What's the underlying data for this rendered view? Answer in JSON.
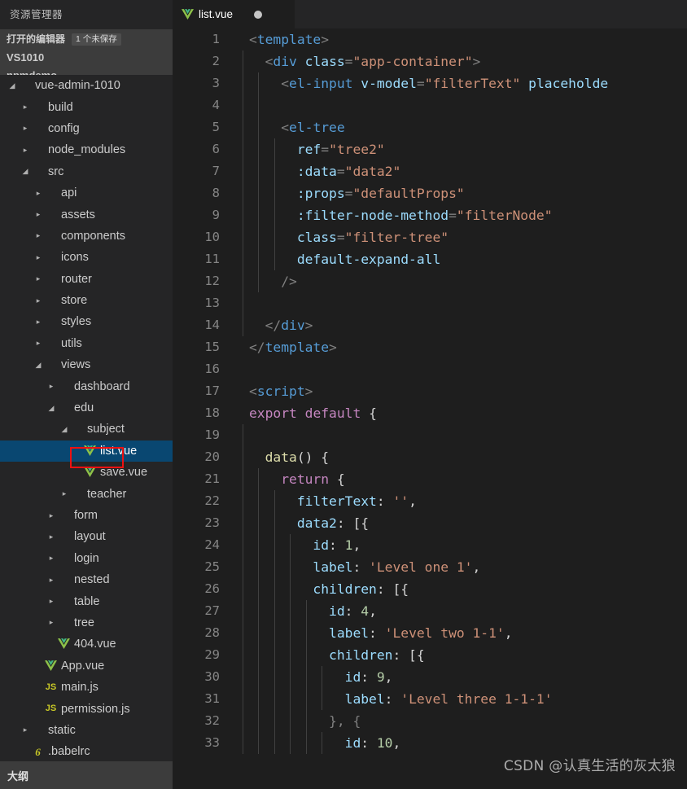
{
  "sidebar": {
    "title": "资源管理器",
    "open_editors": {
      "label": "打开的编辑器",
      "badge": "1 个未保存",
      "workspace": "VS1010"
    },
    "clipped_row_label": "npmdemo",
    "outline_label": "大纲",
    "selection_color": "#094771",
    "annotation_color": "#ee1111",
    "items": [
      {
        "label": "vue-admin-1010",
        "depth": 0,
        "twisty": "expanded",
        "icon": "folder"
      },
      {
        "label": "build",
        "depth": 1,
        "twisty": "collapsed",
        "icon": "folder"
      },
      {
        "label": "config",
        "depth": 1,
        "twisty": "collapsed",
        "icon": "folder"
      },
      {
        "label": "node_modules",
        "depth": 1,
        "twisty": "collapsed",
        "icon": "folder"
      },
      {
        "label": "src",
        "depth": 1,
        "twisty": "expanded",
        "icon": "folder"
      },
      {
        "label": "api",
        "depth": 2,
        "twisty": "collapsed",
        "icon": "folder"
      },
      {
        "label": "assets",
        "depth": 2,
        "twisty": "collapsed",
        "icon": "folder"
      },
      {
        "label": "components",
        "depth": 2,
        "twisty": "collapsed",
        "icon": "folder"
      },
      {
        "label": "icons",
        "depth": 2,
        "twisty": "collapsed",
        "icon": "folder"
      },
      {
        "label": "router",
        "depth": 2,
        "twisty": "collapsed",
        "icon": "folder"
      },
      {
        "label": "store",
        "depth": 2,
        "twisty": "collapsed",
        "icon": "folder"
      },
      {
        "label": "styles",
        "depth": 2,
        "twisty": "collapsed",
        "icon": "folder"
      },
      {
        "label": "utils",
        "depth": 2,
        "twisty": "collapsed",
        "icon": "folder"
      },
      {
        "label": "views",
        "depth": 2,
        "twisty": "expanded",
        "icon": "folder"
      },
      {
        "label": "dashboard",
        "depth": 3,
        "twisty": "collapsed",
        "icon": "folder"
      },
      {
        "label": "edu",
        "depth": 3,
        "twisty": "expanded",
        "icon": "folder"
      },
      {
        "label": "subject",
        "depth": 4,
        "twisty": "expanded",
        "icon": "folder"
      },
      {
        "label": "list.vue",
        "depth": 5,
        "twisty": "none",
        "icon": "vue",
        "selected": true
      },
      {
        "label": "save.vue",
        "depth": 5,
        "twisty": "none",
        "icon": "vue"
      },
      {
        "label": "teacher",
        "depth": 4,
        "twisty": "collapsed",
        "icon": "folder"
      },
      {
        "label": "form",
        "depth": 3,
        "twisty": "collapsed",
        "icon": "folder"
      },
      {
        "label": "layout",
        "depth": 3,
        "twisty": "collapsed",
        "icon": "folder"
      },
      {
        "label": "login",
        "depth": 3,
        "twisty": "collapsed",
        "icon": "folder"
      },
      {
        "label": "nested",
        "depth": 3,
        "twisty": "collapsed",
        "icon": "folder"
      },
      {
        "label": "table",
        "depth": 3,
        "twisty": "collapsed",
        "icon": "folder"
      },
      {
        "label": "tree",
        "depth": 3,
        "twisty": "collapsed",
        "icon": "folder"
      },
      {
        "label": "404.vue",
        "depth": 3,
        "twisty": "none",
        "icon": "vue"
      },
      {
        "label": "App.vue",
        "depth": 2,
        "twisty": "none",
        "icon": "vue"
      },
      {
        "label": "main.js",
        "depth": 2,
        "twisty": "none",
        "icon": "js"
      },
      {
        "label": "permission.js",
        "depth": 2,
        "twisty": "none",
        "icon": "js"
      },
      {
        "label": "static",
        "depth": 1,
        "twisty": "collapsed",
        "icon": "folder"
      },
      {
        "label": ".babelrc",
        "depth": 1,
        "twisty": "none",
        "icon": "babel"
      }
    ]
  },
  "editor": {
    "tab": {
      "label": "list.vue",
      "icon": "vue-icon",
      "dirty": true
    },
    "watermark": "CSDN @认真生活的灰太狼",
    "lines": [
      {
        "n": "1",
        "indent": 0,
        "tokens": [
          [
            "t-punct",
            "<"
          ],
          [
            "t-tag",
            "template"
          ],
          [
            "t-punct",
            ">"
          ]
        ]
      },
      {
        "n": "2",
        "indent": 1,
        "tokens": [
          [
            "t-plain",
            "  "
          ],
          [
            "t-punct",
            "<"
          ],
          [
            "t-tag",
            "div"
          ],
          [
            "t-plain",
            " "
          ],
          [
            "t-attr",
            "class"
          ],
          [
            "t-punct",
            "="
          ],
          [
            "t-str",
            "\"app-container\""
          ],
          [
            "t-punct",
            ">"
          ]
        ]
      },
      {
        "n": "3",
        "indent": 2,
        "tokens": [
          [
            "t-plain",
            "    "
          ],
          [
            "t-punct",
            "<"
          ],
          [
            "t-tag",
            "el-input"
          ],
          [
            "t-plain",
            " "
          ],
          [
            "t-attr",
            "v-model"
          ],
          [
            "t-punct",
            "="
          ],
          [
            "t-str",
            "\"filterText\""
          ],
          [
            "t-plain",
            " "
          ],
          [
            "t-attr",
            "placeholde"
          ]
        ]
      },
      {
        "n": "4",
        "indent": 2,
        "tokens": []
      },
      {
        "n": "5",
        "indent": 2,
        "tokens": [
          [
            "t-plain",
            "    "
          ],
          [
            "t-punct",
            "<"
          ],
          [
            "t-tag",
            "el-tree"
          ]
        ]
      },
      {
        "n": "6",
        "indent": 3,
        "tokens": [
          [
            "t-plain",
            "      "
          ],
          [
            "t-attr",
            "ref"
          ],
          [
            "t-punct",
            "="
          ],
          [
            "t-str",
            "\"tree2\""
          ]
        ]
      },
      {
        "n": "7",
        "indent": 3,
        "tokens": [
          [
            "t-plain",
            "      "
          ],
          [
            "t-attr",
            ":data"
          ],
          [
            "t-punct",
            "="
          ],
          [
            "t-str",
            "\"data2\""
          ]
        ]
      },
      {
        "n": "8",
        "indent": 3,
        "tokens": [
          [
            "t-plain",
            "      "
          ],
          [
            "t-attr",
            ":props"
          ],
          [
            "t-punct",
            "="
          ],
          [
            "t-str",
            "\"defaultProps\""
          ]
        ]
      },
      {
        "n": "9",
        "indent": 3,
        "tokens": [
          [
            "t-plain",
            "      "
          ],
          [
            "t-attr",
            ":filter-node-method"
          ],
          [
            "t-punct",
            "="
          ],
          [
            "t-str",
            "\"filterNode\""
          ]
        ]
      },
      {
        "n": "10",
        "indent": 3,
        "tokens": [
          [
            "t-plain",
            "      "
          ],
          [
            "t-attr",
            "class"
          ],
          [
            "t-punct",
            "="
          ],
          [
            "t-str",
            "\"filter-tree\""
          ]
        ]
      },
      {
        "n": "11",
        "indent": 3,
        "tokens": [
          [
            "t-plain",
            "      "
          ],
          [
            "t-attr",
            "default-expand-all"
          ]
        ]
      },
      {
        "n": "12",
        "indent": 2,
        "tokens": [
          [
            "t-plain",
            "    "
          ],
          [
            "t-punct",
            "/>"
          ]
        ]
      },
      {
        "n": "13",
        "indent": 1,
        "tokens": []
      },
      {
        "n": "14",
        "indent": 1,
        "tokens": [
          [
            "t-plain",
            "  "
          ],
          [
            "t-punct",
            "</"
          ],
          [
            "t-tag",
            "div"
          ],
          [
            "t-punct",
            ">"
          ]
        ]
      },
      {
        "n": "15",
        "indent": 0,
        "tokens": [
          [
            "t-punct",
            "</"
          ],
          [
            "t-tag",
            "template"
          ],
          [
            "t-punct",
            ">"
          ]
        ]
      },
      {
        "n": "16",
        "indent": 0,
        "tokens": []
      },
      {
        "n": "17",
        "indent": 0,
        "tokens": [
          [
            "t-punct",
            "<"
          ],
          [
            "t-tag",
            "script"
          ],
          [
            "t-punct",
            ">"
          ]
        ]
      },
      {
        "n": "18",
        "indent": 0,
        "tokens": [
          [
            "t-kw",
            "export"
          ],
          [
            "t-plain",
            " "
          ],
          [
            "t-kw",
            "default"
          ],
          [
            "t-plain",
            " "
          ],
          [
            "t-plain",
            "{"
          ]
        ]
      },
      {
        "n": "19",
        "indent": 1,
        "tokens": []
      },
      {
        "n": "20",
        "indent": 1,
        "tokens": [
          [
            "t-plain",
            "  "
          ],
          [
            "t-fn",
            "data"
          ],
          [
            "t-plain",
            "() {"
          ]
        ]
      },
      {
        "n": "21",
        "indent": 2,
        "tokens": [
          [
            "t-plain",
            "    "
          ],
          [
            "t-kw",
            "return"
          ],
          [
            "t-plain",
            " {"
          ]
        ]
      },
      {
        "n": "22",
        "indent": 3,
        "tokens": [
          [
            "t-plain",
            "      "
          ],
          [
            "t-prop",
            "filterText"
          ],
          [
            "t-plain",
            ": "
          ],
          [
            "t-str",
            "''"
          ],
          [
            "t-plain",
            ","
          ]
        ]
      },
      {
        "n": "23",
        "indent": 3,
        "tokens": [
          [
            "t-plain",
            "      "
          ],
          [
            "t-prop",
            "data2"
          ],
          [
            "t-plain",
            ": [{"
          ]
        ]
      },
      {
        "n": "24",
        "indent": 4,
        "tokens": [
          [
            "t-plain",
            "        "
          ],
          [
            "t-prop",
            "id"
          ],
          [
            "t-plain",
            ": "
          ],
          [
            "t-num",
            "1"
          ],
          [
            "t-plain",
            ","
          ]
        ]
      },
      {
        "n": "25",
        "indent": 4,
        "tokens": [
          [
            "t-plain",
            "        "
          ],
          [
            "t-prop",
            "label"
          ],
          [
            "t-plain",
            ": "
          ],
          [
            "t-str",
            "'Level one 1'"
          ],
          [
            "t-plain",
            ","
          ]
        ]
      },
      {
        "n": "26",
        "indent": 4,
        "tokens": [
          [
            "t-plain",
            "        "
          ],
          [
            "t-prop",
            "children"
          ],
          [
            "t-plain",
            ": [{"
          ]
        ]
      },
      {
        "n": "27",
        "indent": 5,
        "tokens": [
          [
            "t-plain",
            "          "
          ],
          [
            "t-prop",
            "id"
          ],
          [
            "t-plain",
            ": "
          ],
          [
            "t-num",
            "4"
          ],
          [
            "t-plain",
            ","
          ]
        ]
      },
      {
        "n": "28",
        "indent": 5,
        "tokens": [
          [
            "t-plain",
            "          "
          ],
          [
            "t-prop",
            "label"
          ],
          [
            "t-plain",
            ": "
          ],
          [
            "t-str",
            "'Level two 1-1'"
          ],
          [
            "t-plain",
            ","
          ]
        ]
      },
      {
        "n": "29",
        "indent": 5,
        "tokens": [
          [
            "t-plain",
            "          "
          ],
          [
            "t-prop",
            "children"
          ],
          [
            "t-plain",
            ": [{"
          ]
        ]
      },
      {
        "n": "30",
        "indent": 6,
        "tokens": [
          [
            "t-plain",
            "            "
          ],
          [
            "t-prop",
            "id"
          ],
          [
            "t-plain",
            ": "
          ],
          [
            "t-num",
            "9"
          ],
          [
            "t-plain",
            ","
          ]
        ]
      },
      {
        "n": "31",
        "indent": 6,
        "tokens": [
          [
            "t-plain",
            "            "
          ],
          [
            "t-prop",
            "label"
          ],
          [
            "t-plain",
            ": "
          ],
          [
            "t-str",
            "'Level three 1-1-1'"
          ]
        ]
      },
      {
        "n": "32",
        "indent": 5,
        "tokens": [
          [
            "t-plain",
            "          "
          ],
          [
            "t-punct",
            "}, {"
          ]
        ]
      },
      {
        "n": "33",
        "indent": 6,
        "tokens": [
          [
            "t-plain",
            "            "
          ],
          [
            "t-prop",
            "id"
          ],
          [
            "t-plain",
            ": "
          ],
          [
            "t-num",
            "10"
          ],
          [
            "t-plain",
            ","
          ]
        ]
      }
    ]
  }
}
